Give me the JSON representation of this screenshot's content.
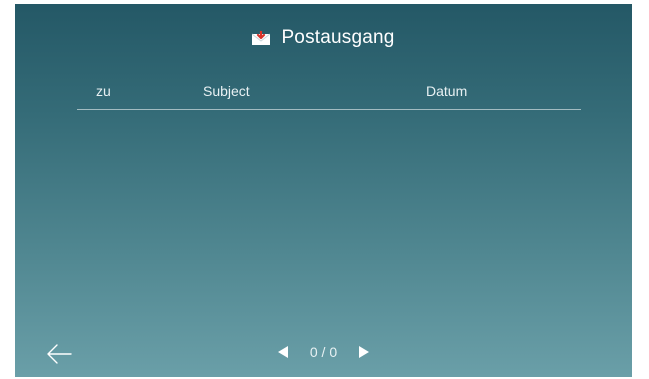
{
  "header": {
    "icon": "mail-icon",
    "title": "Postausgang"
  },
  "table": {
    "columns": [
      "zu",
      "Subject",
      "Datum"
    ],
    "rows": []
  },
  "pagination": {
    "page_label": "0 / 0",
    "prev_icon": "triangle-left-icon",
    "next_icon": "triangle-right-icon"
  },
  "nav": {
    "back_icon": "arrow-left-icon"
  },
  "colors": {
    "gradient_top": "#245866",
    "gradient_bottom": "#6a9fa8",
    "text": "#ffffff",
    "icon_red": "#d9342b"
  }
}
